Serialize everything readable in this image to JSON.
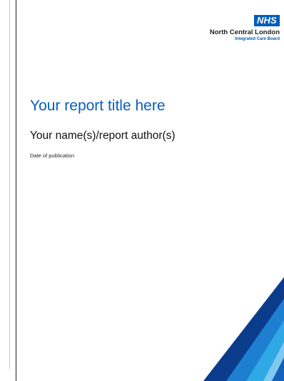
{
  "logo": {
    "badge": "NHS",
    "org_name": "North Central London",
    "org_subtitle": "Integrated Care Board"
  },
  "document": {
    "title": "Your report title here",
    "author": "Your name(s)/report author(s)",
    "date": "Date of publication"
  },
  "colors": {
    "nhs_blue": "#005eb8",
    "title_blue": "#0b5fb8",
    "stripe_dark": "#0b3c8c",
    "stripe_mid": "#1e7fd0",
    "stripe_light": "#2fa8e6",
    "stripe_pale": "#7fc8f0"
  }
}
